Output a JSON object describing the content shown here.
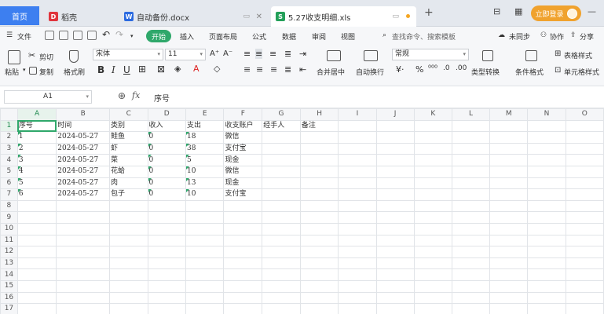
{
  "tabs": {
    "home": "首页",
    "docer": "稻壳",
    "doc": "自动备份.docx",
    "xls": "5.27收支明细.xls",
    "new_tab": "+"
  },
  "title_right": {
    "login": "立即登录"
  },
  "menu": {
    "file": "文件",
    "start": "开始",
    "items": [
      "插入",
      "页面布局",
      "公式",
      "数据",
      "审阅",
      "视图"
    ],
    "search": "查找命令、搜索模板",
    "cloud_sync": "未同步",
    "collab": "协作",
    "share": "分享"
  },
  "ribbon": {
    "paste": "粘贴",
    "cut": "剪切",
    "copy": "复制",
    "format_painter": "格式刷",
    "font": "宋体",
    "font_size": "11",
    "merge": "合并居中",
    "wrap": "自动换行",
    "number_format": "常规",
    "type_convert": "类型转换",
    "cond_format": "条件格式",
    "table_style": "表格样式",
    "cell_style": "单元格样式"
  },
  "formula_bar": {
    "cell_ref": "A1",
    "fx": "fx",
    "value": "序号"
  },
  "sheet": {
    "columns": [
      "A",
      "B",
      "C",
      "D",
      "E",
      "F",
      "G",
      "H",
      "I",
      "J",
      "K",
      "L",
      "M",
      "N",
      "O"
    ],
    "header_row": [
      "序号",
      "时间",
      "类别",
      "收入",
      "支出",
      "收支账户",
      "经手人",
      "备注"
    ],
    "rows": [
      [
        "1",
        "2024-05-27",
        "鲑鱼",
        "0",
        "18",
        "微信"
      ],
      [
        "2",
        "2024-05-27",
        "虾",
        "0",
        "38",
        "支付宝"
      ],
      [
        "3",
        "2024-05-27",
        "菜",
        "0",
        "5",
        "现金"
      ],
      [
        "4",
        "2024-05-27",
        "花蛤",
        "0",
        "10",
        "微信"
      ],
      [
        "5",
        "2024-05-27",
        "肉",
        "0",
        "13",
        "现金"
      ],
      [
        "6",
        "2024-05-27",
        "包子",
        "0",
        "10",
        "支付宝"
      ]
    ],
    "row_numbers": [
      "1",
      "2",
      "3",
      "4",
      "5",
      "6",
      "7",
      "8",
      "9",
      "10",
      "11",
      "12",
      "13",
      "14",
      "15",
      "16",
      "17"
    ]
  }
}
